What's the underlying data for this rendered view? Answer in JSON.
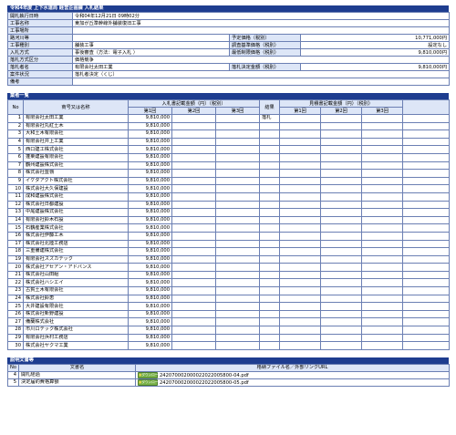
{
  "header": {
    "title": "令和4年度 上下水道局 経営企画課 入札結果"
  },
  "info": {
    "rows": [
      {
        "label": "開札執行日時",
        "value": "令和04年12月21日 09時02分"
      },
      {
        "label": "工事名称",
        "value": "東加が丘準幹線外舗装復旧工事"
      },
      {
        "label": "工事場所",
        "value": ""
      },
      {
        "label": "路河川等",
        "value": "",
        "label2": "予定価格（税別）",
        "value2": "10,771,000円"
      },
      {
        "label": "工事種別",
        "value": "舗装工事",
        "label2": "調査基準価格（税別）",
        "value2": "設定なし"
      },
      {
        "label": "入札方式",
        "value": "事後審査（方法：電子入札 ）",
        "label2": "最低制限価格（税別）",
        "value2": "9,810,000円"
      },
      {
        "label": "落札方式区分",
        "value": "価格競争"
      },
      {
        "label": "落札者名",
        "value": "有限会社太田工業",
        "label2": "落札決定金額（税別）",
        "value2": "9,810,000円"
      },
      {
        "label": "案件状況",
        "value": "落札者決定（くじ）"
      },
      {
        "label": "備考",
        "value": ""
      }
    ]
  },
  "bidders": {
    "title": "業者一覧",
    "headers": {
      "no": "No",
      "name": "商号又は名称",
      "bid_group": "入札書記載金額（円）（税別）",
      "first": "第1回",
      "second": "第2回",
      "third": "第3回",
      "result": "結果",
      "cost_group": "見積書記載金額（円）（税別）"
    },
    "rows": [
      {
        "no": "1",
        "name": "有限会社太田工業",
        "amount": "9,810,000",
        "result": "落札"
      },
      {
        "no": "2",
        "name": "有限会社丸紅土木",
        "amount": "9,810,000",
        "result": ""
      },
      {
        "no": "3",
        "name": "大和土木有限会社",
        "amount": "9,810,000",
        "result": ""
      },
      {
        "no": "4",
        "name": "有限会社井上工業",
        "amount": "9,810,000",
        "result": ""
      },
      {
        "no": "5",
        "name": "西口建工株式会社",
        "amount": "9,810,000",
        "result": ""
      },
      {
        "no": "6",
        "name": "蓬莱建設有限会社",
        "amount": "9,810,000",
        "result": ""
      },
      {
        "no": "7",
        "name": "鶴州建設株式会社",
        "amount": "9,810,000",
        "result": ""
      },
      {
        "no": "8",
        "name": "株式会社豊嶺",
        "amount": "9,810,000",
        "result": ""
      },
      {
        "no": "9",
        "name": "イケダアクト株式会社",
        "amount": "9,810,000",
        "result": ""
      },
      {
        "no": "10",
        "name": "株式会社大久保建設",
        "amount": "9,810,000",
        "result": ""
      },
      {
        "no": "11",
        "name": "成和建設株式会社",
        "amount": "9,810,000",
        "result": ""
      },
      {
        "no": "12",
        "name": "株式会社日都建設",
        "amount": "9,810,000",
        "result": ""
      },
      {
        "no": "13",
        "name": "中尾建設株式会社",
        "amount": "9,810,000",
        "result": ""
      },
      {
        "no": "14",
        "name": "有限会社鈴木石設",
        "amount": "9,810,000",
        "result": ""
      },
      {
        "no": "15",
        "name": "石鶴産業株式会社",
        "amount": "9,810,000",
        "result": ""
      },
      {
        "no": "16",
        "name": "株式会社伊藤工木",
        "amount": "9,810,000",
        "result": ""
      },
      {
        "no": "17",
        "name": "株式会社北陸工務店",
        "amount": "9,810,000",
        "result": ""
      },
      {
        "no": "18",
        "name": "三重備建株式会社",
        "amount": "9,810,000",
        "result": ""
      },
      {
        "no": "19",
        "name": "有限会社スズカテック",
        "amount": "9,810,000",
        "result": ""
      },
      {
        "no": "20",
        "name": "株式会社アセアン・アドバンス",
        "amount": "9,810,000",
        "result": ""
      },
      {
        "no": "21",
        "name": "株式会社山田組",
        "amount": "9,810,000",
        "result": ""
      },
      {
        "no": "22",
        "name": "株式会社ハシエイ",
        "amount": "9,810,000",
        "result": ""
      },
      {
        "no": "23",
        "name": "古賀土木有限会社",
        "amount": "9,810,000",
        "result": ""
      },
      {
        "no": "24",
        "name": "株式会社鈴恵",
        "amount": "9,810,000",
        "result": ""
      },
      {
        "no": "25",
        "name": "大井建設有限会社",
        "amount": "9,810,000",
        "result": ""
      },
      {
        "no": "26",
        "name": "株式会社新野建設",
        "amount": "9,810,000",
        "result": ""
      },
      {
        "no": "27",
        "name": "備蘭株式会社",
        "amount": "9,810,000",
        "result": ""
      },
      {
        "no": "28",
        "name": "市川ロテック株式会社",
        "amount": "9,810,000",
        "result": ""
      },
      {
        "no": "29",
        "name": "有限会社浜村工務店",
        "amount": "9,810,000",
        "result": ""
      },
      {
        "no": "30",
        "name": "株式会社ヤクマ工業",
        "amount": "9,810,000",
        "result": ""
      }
    ]
  },
  "docs": {
    "title": "説明文書等",
    "headers": {
      "no": "No",
      "name": "文書名",
      "file": "格納ファイル名／外部リンクURL"
    },
    "download_label": "ダウンロード",
    "rows": [
      {
        "no": "4",
        "name": "開札経過",
        "file": "242070002000022022005800-04.pdf"
      },
      {
        "no": "5",
        "name": "決定届約費格算額",
        "file": "242070002000022022005800-05.pdf"
      }
    ]
  },
  "colors": {
    "header_bg": "#1e3d8f",
    "label_bg": "#dde6f7",
    "border": "#6b7fb3",
    "button_green": "#7ab24a"
  }
}
